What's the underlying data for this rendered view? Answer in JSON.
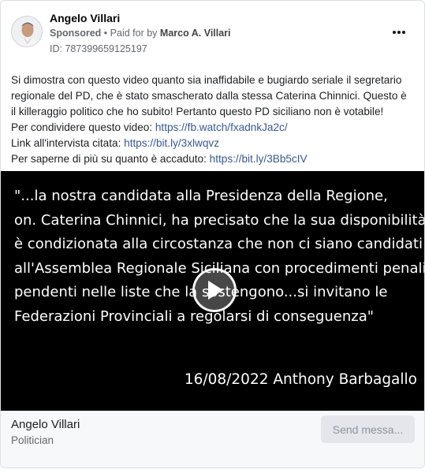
{
  "advertiser": {
    "name": "Angelo Villari",
    "sponsored_label": "Sponsored",
    "separator": "•",
    "paid_for_label": "Paid for by",
    "payer": "Marco A. Villari",
    "ad_id": "ID: 787399659125197"
  },
  "post": {
    "lines": [
      "Si dimostra con questo video quanto sia inaffidabile e bugiardo seriale il segretario",
      "regionale del PD, che è stato smascherato dalla stessa Caterina Chinnici. Questo è",
      "il killeraggio politico che ho subito! Pertanto questo PD siciliano non è votabile!"
    ],
    "links": [
      {
        "prefix": "Per condividere questo video: ",
        "url": "https://fb.watch/fxadnkJa2c/"
      },
      {
        "prefix": "Link all'intervista citata: ",
        "url": "https://bit.ly/3xlwqvz"
      },
      {
        "prefix": "Per saperne di più su quanto è accaduto: ",
        "url": "https://bit.ly/3Bb5cIV"
      }
    ]
  },
  "video": {
    "quote_lines": [
      "\"...la nostra candidata alla Presidenza della Regione,",
      "on. Caterina Chinnici, ha precisato che la sua disponibilità",
      "è condizionata alla circostanza che non ci siano candidati",
      "all'Assemblea Regionale Siciliana con procedimenti penali",
      "pendenti nelle liste che la sostengono...si invitano le",
      "Federazioni Provinciali a regolarsi di conseguenza\""
    ],
    "attribution": "16/08/2022 Anthony Barbagallo",
    "play_icon": "play-icon"
  },
  "footer": {
    "page_name": "Angelo Villari",
    "category": "Politician",
    "send_button": "Send messa..."
  },
  "colors": {
    "link": "#385898",
    "secondary_text": "#65676b",
    "video_bg": "#000000",
    "button_bg": "#e4e6eb"
  }
}
